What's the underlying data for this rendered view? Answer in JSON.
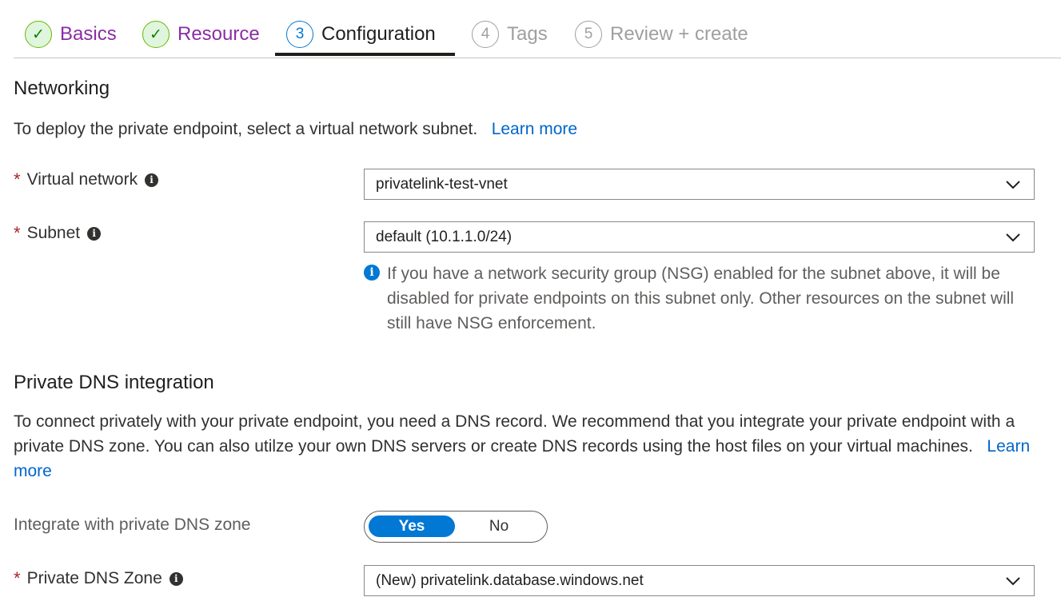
{
  "tabs": [
    {
      "marker": "✓",
      "label": "Basics",
      "state": "done"
    },
    {
      "marker": "✓",
      "label": "Resource",
      "state": "done"
    },
    {
      "marker": "3",
      "label": "Configuration",
      "state": "active"
    },
    {
      "marker": "4",
      "label": "Tags",
      "state": "pending"
    },
    {
      "marker": "5",
      "label": "Review + create",
      "state": "pending"
    }
  ],
  "networking": {
    "heading": "Networking",
    "description": "To deploy the private endpoint, select a virtual network subnet.",
    "learn_more": "Learn more",
    "virtual_network": {
      "required_mark": "*",
      "label": "Virtual network",
      "value": "privatelink-test-vnet"
    },
    "subnet": {
      "required_mark": "*",
      "label": "Subnet",
      "value": "default (10.1.1.0/24)"
    },
    "nsg_note": "If you have a network security group (NSG) enabled for the subnet above, it will be disabled for private endpoints on this subnet only. Other resources on the subnet will still have NSG enforcement."
  },
  "dns": {
    "heading": "Private DNS integration",
    "description": "To connect privately with your private endpoint, you need a DNS record. We recommend that you integrate your private endpoint with a private DNS zone. You can also utilze your own DNS servers or create DNS records using the host files on your virtual machines.",
    "learn_more": "Learn more",
    "integrate": {
      "label": "Integrate with private DNS zone",
      "yes_label": "Yes",
      "no_label": "No",
      "selected": "Yes"
    },
    "zone": {
      "required_mark": "*",
      "label": "Private DNS Zone",
      "value": "(New) privatelink.database.windows.net"
    }
  },
  "icons": {
    "info": "i",
    "check": "✓"
  },
  "colors": {
    "accent": "#0078d4",
    "link": "#0066cc",
    "done_tab": "#8a2da5",
    "required": "#a4262c",
    "check_fill": "#dff6dd"
  }
}
